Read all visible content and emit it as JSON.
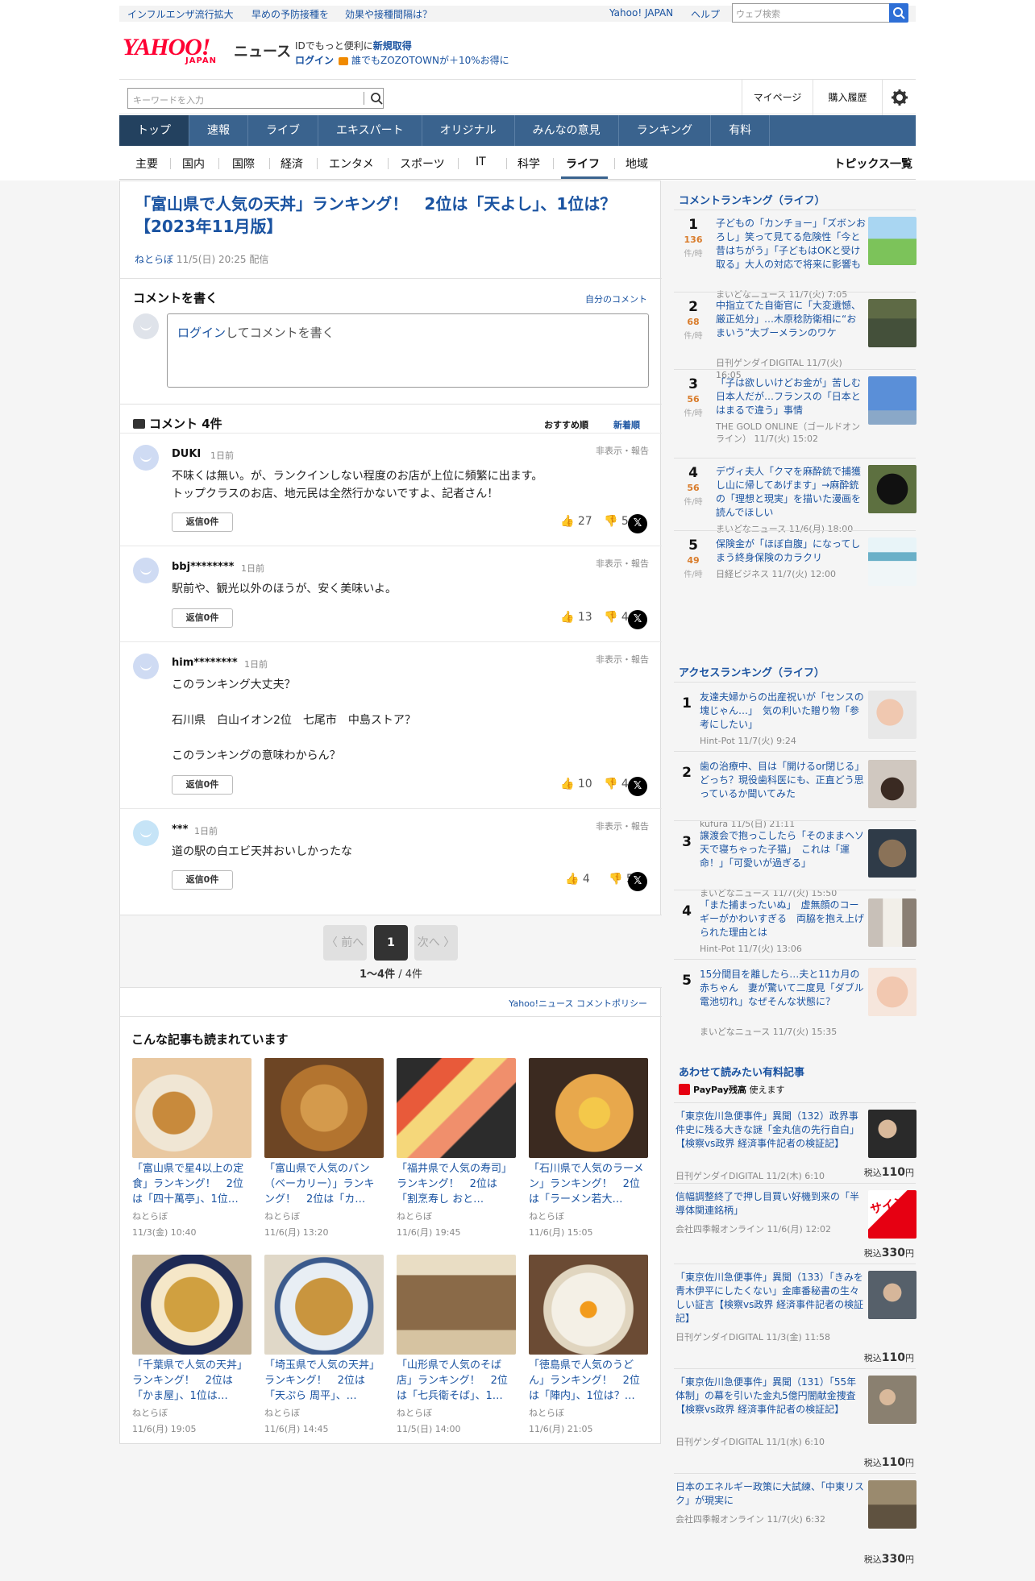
{
  "promo": {
    "items": [
      "インフルエンザ流行拡大",
      "早めの予防接種を",
      "効果や接種間隔は？"
    ]
  },
  "header": {
    "yahoo_japan": "Yahoo! JAPAN",
    "help": "ヘルプ",
    "web_search_placeholder": "ウェブ検索",
    "logo": "YAHOO!",
    "logo_sub": "JAPAN",
    "news_label": "ニュース",
    "id_prefix": "IDでもっと便利に",
    "id_register": "新規取得",
    "login": "ログイン",
    "zozo": "誰でもZOZOTOWNが＋10%お得に"
  },
  "search": {
    "placeholder": "キーワードを入力",
    "mypage": "マイページ",
    "history": "購入履歴"
  },
  "main_nav": [
    "トップ",
    "速報",
    "ライブ",
    "エキスパート",
    "オリジナル",
    "みんなの意見",
    "ランキング",
    "有料"
  ],
  "sub_nav": [
    "主要",
    "国内",
    "国際",
    "経済",
    "エンタメ",
    "スポーツ",
    "IT",
    "科学",
    "ライフ",
    "地域"
  ],
  "sub_nav_topics": "トピックス一覧",
  "article": {
    "title": "「富山県で人気の天丼」ランキング！　2位は「天よし」、1位は？【2023年11月版】",
    "source": "ねとらぼ",
    "date": "11/5(日) 20:25 配信"
  },
  "write": {
    "heading": "コメントを書く",
    "my_comments": "自分のコメント",
    "login_link": "ログイン",
    "placeholder": "してコメントを書く"
  },
  "comments_header": {
    "title": "コメント 4件",
    "sort_recommended": "おすすめ順",
    "sort_newest": "新着順"
  },
  "comments": [
    {
      "name": "DUKI",
      "time": "1日前",
      "report": "非表示・報告",
      "lines": [
        "不味くは無い。が、ランクインしない程度のお店が上位に頻繁に出ます。",
        "トップクラスのお店、地元民は全然行かないですよ、記者さん！"
      ],
      "reply": "返信0件",
      "likes": "27",
      "dislikes": "5"
    },
    {
      "name": "bbj********",
      "time": "1日前",
      "report": "非表示・報告",
      "lines": [
        "駅前や、観光以外のほうが、安く美味いよ。"
      ],
      "reply": "返信0件",
      "likes": "13",
      "dislikes": "4"
    },
    {
      "name": "him********",
      "time": "1日前",
      "report": "非表示・報告",
      "lines": [
        "このランキング大丈夫？",
        "",
        "石川県　白山イオン2位　七尾市　中島ストア？",
        "",
        "このランキングの意味わからん？"
      ],
      "reply": "返信0件",
      "likes": "10",
      "dislikes": "4"
    },
    {
      "name": "***",
      "time": "1日前",
      "report": "非表示・報告",
      "lines": [
        "道の駅の白エビ天丼おいしかったな"
      ],
      "reply": "返信0件",
      "likes": "4",
      "dislikes": "5"
    }
  ],
  "pager": {
    "prev": "〈 前へ",
    "current": "1",
    "next": "次へ 〉",
    "range": "1〜4件",
    "total": " / 4件"
  },
  "policy": "Yahoo!ニュース コメントポリシー",
  "related": {
    "heading": "こんな記事も読まれています",
    "items": [
      {
        "title": "「富山県で星4以上の定食」ランキング！　2位は「四十萬亭」、1位…",
        "source": "ねとらぼ",
        "date": "11/3(金) 10:40"
      },
      {
        "title": "「富山県で人気のパン（ベーカリー）」ランキング！　2位は「カ…",
        "source": "ねとらぼ",
        "date": "11/6(月) 13:20"
      },
      {
        "title": "「福井県で人気の寿司」ランキング！　2位は「割烹寿し おと…",
        "source": "ねとらぼ",
        "date": "11/6(月) 19:45"
      },
      {
        "title": "「石川県で人気のラーメン」ランキング！　2位は「ラーメン若大…",
        "source": "ねとらぼ",
        "date": "11/6(月) 15:05"
      },
      {
        "title": "「千葉県で人気の天丼」ランキング！　2位は「かま屋」、1位は…",
        "source": "ねとらぼ",
        "date": "11/6(月) 19:05"
      },
      {
        "title": "「埼玉県で人気の天丼」ランキング！　2位は「天ぷら 周平」、…",
        "source": "ねとらぼ",
        "date": "11/6(月) 14:45"
      },
      {
        "title": "「山形県で人気のそば店」ランキング！　2位は「七兵衛そば」、1…",
        "source": "ねとらぼ",
        "date": "11/5(日) 14:00"
      },
      {
        "title": "「徳島県で人気のうどん」ランキング！　2位は「陣内」、1位は？…",
        "source": "ねとらぼ",
        "date": "11/6(月) 21:05"
      }
    ]
  },
  "comment_ranking": {
    "heading": "コメントランキング（ライフ）",
    "unit": "件/時",
    "items": [
      {
        "rank": "1",
        "count": "136",
        "title": "子どもの「カンチョー」「ズボンおろし」笑って見てる危険性「今と昔はちがう」「子どもはOKと受け取る」大人の対応で将来に影響も",
        "source": "まいどなニュース 11/7(火) 7:05"
      },
      {
        "rank": "2",
        "count": "68",
        "title": "中指立てた自衛官に「大変遺憾、厳正処分」…木原稔防衛相に“おまいう”大ブーメランのワケ",
        "source": "日刊ゲンダイDIGITAL 11/7(火) 16:05"
      },
      {
        "rank": "3",
        "count": "56",
        "title": "「子は欲しいけどお金が」苦しむ日本人だが…フランスの「日本とはまるで違う」事情",
        "source": "THE GOLD ONLINE（ゴールドオンライン） 11/7(火) 15:02"
      },
      {
        "rank": "4",
        "count": "56",
        "title": "デヴィ夫人「クマを麻酔銃で捕獲し山に帰してあげます」→麻酔銃の「理想と現実」を描いた漫画を読んでほしい",
        "source": "まいどなニュース 11/6(月) 18:00"
      },
      {
        "rank": "5",
        "count": "49",
        "title": "保険金が「ほぼ自腹」になってしまう終身保険のカラクリ",
        "source": "日経ビジネス 11/7(火) 12:00"
      }
    ]
  },
  "access_ranking": {
    "heading": "アクセスランキング（ライフ）",
    "items": [
      {
        "rank": "1",
        "title": "友達夫婦からの出産祝いが「センスの塊じゃん…」　気の利いた贈り物「参考にしたい」",
        "source": "Hint-Pot 11/7(火) 9:24"
      },
      {
        "rank": "2",
        "title": "歯の治療中、目は「開けるor閉じる」どっち？現役歯科医にも、正直どう思っているか聞いてみた",
        "source": "kufura 11/5(日) 21:11"
      },
      {
        "rank": "3",
        "title": "譲渡会で抱っこしたら「そのままヘソ天で寝ちゃった子猫」　これは「運命！」「可愛いが過ぎる」",
        "source": "まいどなニュース 11/7(火) 15:50"
      },
      {
        "rank": "4",
        "title": "「また捕まったいぬ」　虚無顔のコーギーがかわいすぎる　両脇を抱え上げられた理由とは",
        "source": "Hint-Pot 11/7(火) 13:06"
      },
      {
        "rank": "5",
        "title": "15分間目を離したら…夫と11カ月の赤ちゃん　妻が驚いて二度見「ダブル電池切れ」なぜそんな状態に？",
        "source": "まいどなニュース 11/7(火) 15:35"
      }
    ]
  },
  "paid": {
    "heading": "あわせて読みたい有料記事",
    "paypay": "PayPay残高",
    "paypay_suffix": "使えます",
    "items": [
      {
        "title": "「東京佐川急便事件」異聞（132）政界事件史に残る大きな謎「金丸信の先行自白」【検察vs政界 経済事件記者の検証記】",
        "source": "日刊ゲンダイDIGITAL 11/2(木) 6:10",
        "tax": "税込",
        "price": "110",
        "yen": "円"
      },
      {
        "title": "信幅調整終了で押し目買い好機到来の「半導体関連銘柄」",
        "source": "会社四季報オンライン 11/6(月) 12:02",
        "tax": "税込",
        "price": "330",
        "yen": "円",
        "thumb_text": "サイン"
      },
      {
        "title": "「東京佐川急便事件」異聞（133）「きみを青木伊平にしたくない」金庫番秘書の生々しい証言【検察vs政界 経済事件記者の検証記】",
        "source": "日刊ゲンダイDIGITAL 11/3(金) 11:58",
        "tax": "税込",
        "price": "110",
        "yen": "円"
      },
      {
        "title": "「東京佐川急便事件」異聞（131）「55年体制」の幕を引いた金丸5億円闇献金捜査【検察vs政界 経済事件記者の検証記】",
        "source": "日刊ゲンダイDIGITAL 11/1(水) 6:10",
        "tax": "税込",
        "price": "110",
        "yen": "円"
      },
      {
        "title": "日本のエネルギー政策に大試練、「中東リスク」が現実に",
        "source": "会社四季報オンライン 11/7(火) 6:32",
        "tax": "税込",
        "price": "330",
        "yen": "円"
      }
    ]
  },
  "colors": {
    "brand_red": "#ff0033",
    "link_blue": "#1a53a1",
    "nav_blue": "#3a638e",
    "rank_orange": "#d97c2b"
  }
}
